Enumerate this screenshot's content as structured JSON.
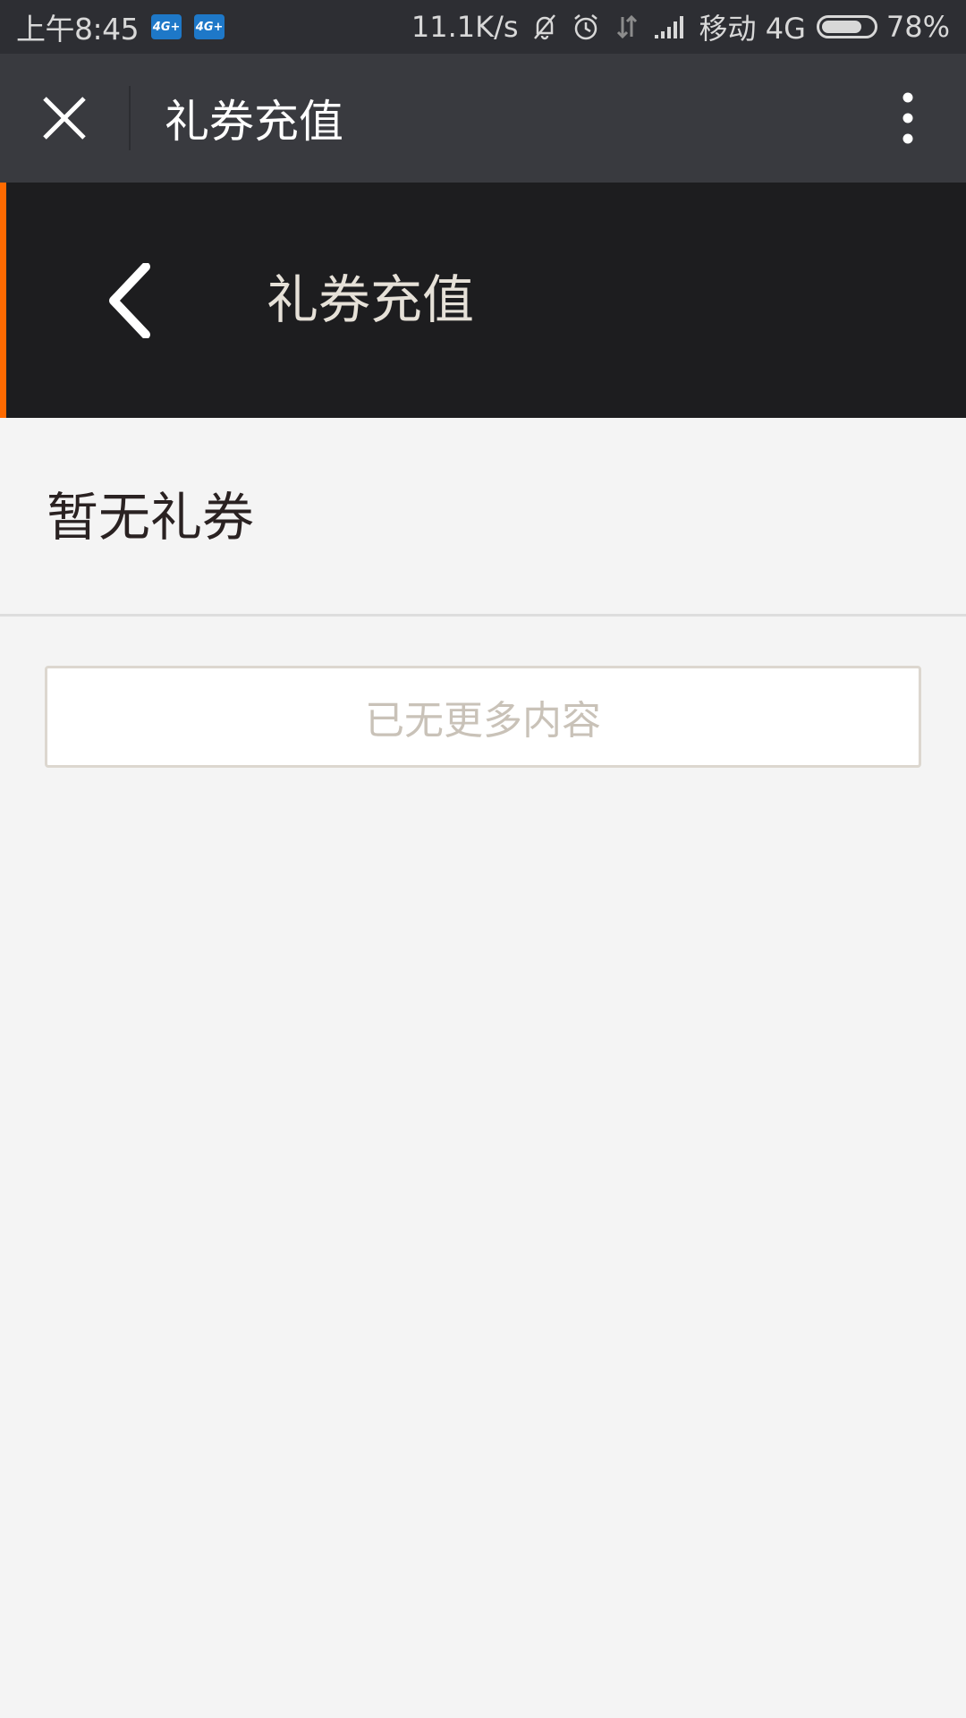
{
  "status_bar": {
    "time": "上午8:45",
    "network_badges": [
      "4G+",
      "4G+"
    ],
    "speed": "11.1K/s",
    "carrier": "移动 4G",
    "battery_percent_text": "78%",
    "battery_level": 0.78,
    "icons": [
      "mute-bell-icon",
      "alarm-icon",
      "data-arrows-icon",
      "signal-icon"
    ]
  },
  "top_bar": {
    "title": "礼券充值",
    "close_icon": "close-icon",
    "more_icon": "more-vertical-icon"
  },
  "page_header": {
    "title": "礼券充值",
    "back_icon": "chevron-left-icon",
    "accent_color": "#ff6a00"
  },
  "content": {
    "empty_message": "暂无礼券",
    "no_more_label": "已无更多内容"
  }
}
